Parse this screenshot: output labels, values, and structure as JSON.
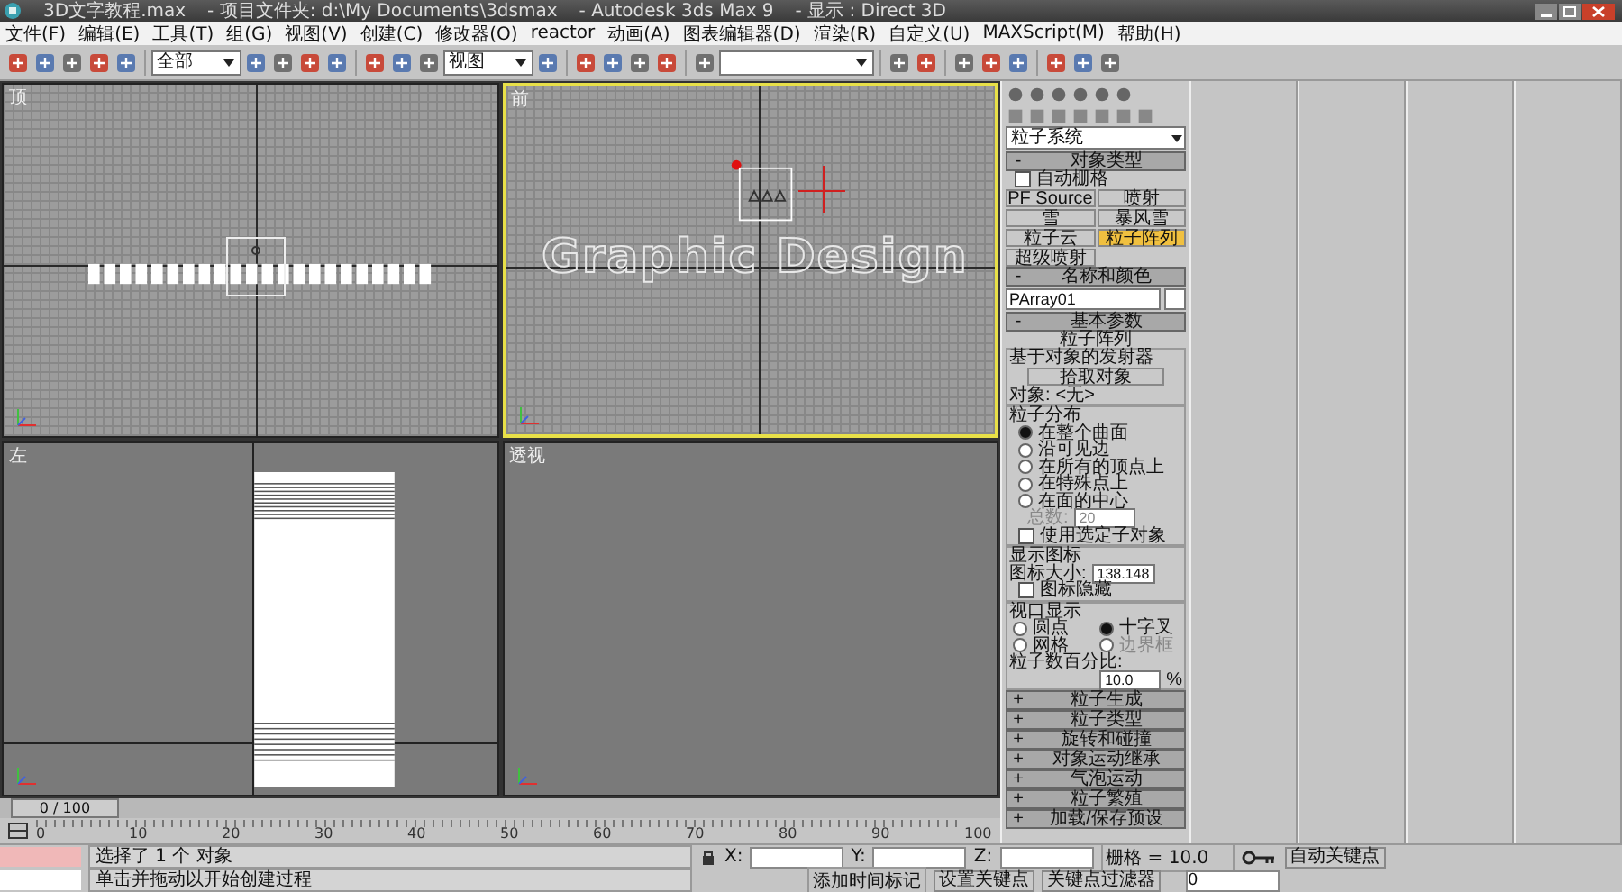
{
  "title_bar": {
    "file": "3D文字教程.max",
    "project": "- 项目文件夹: d:\\My Documents\\3dsmax",
    "app": "- Autodesk 3ds Max 9",
    "display": "- 显示 : Direct 3D"
  },
  "menu": [
    "文件(F)",
    "编辑(E)",
    "工具(T)",
    "组(G)",
    "视图(V)",
    "创建(C)",
    "修改器(O)",
    "reactor",
    "动画(A)",
    "图表编辑器(D)",
    "渲染(R)",
    "自定义(U)",
    "MAXScript(M)",
    "帮助(H)"
  ],
  "toolbar": {
    "selection_filter": "全部",
    "coordinate_system": "视图"
  },
  "viewports": [
    {
      "label": "顶",
      "kind": "top",
      "selected": false
    },
    {
      "label": "前",
      "kind": "front",
      "selected": true,
      "text": "Graphic Design"
    },
    {
      "label": "左",
      "kind": "left",
      "selected": false
    },
    {
      "label": "透视",
      "kind": "perspective",
      "selected": false
    }
  ],
  "command_panel": {
    "category": "粒子系统",
    "object_type": {
      "sign": "-",
      "title": "对象类型",
      "autogrid": {
        "label": "自动栅格",
        "checked": false
      },
      "buttons": [
        {
          "label": "PF Source",
          "selected": false
        },
        {
          "label": "喷射",
          "selected": false
        },
        {
          "label": "雪",
          "selected": false
        },
        {
          "label": "暴风雪",
          "selected": false
        },
        {
          "label": "粒子云",
          "selected": false
        },
        {
          "label": "粒子阵列",
          "selected": true
        },
        {
          "label": "超级喷射",
          "selected": false
        }
      ]
    },
    "name_color": {
      "sign": "-",
      "title": "名称和颜色",
      "name": "PArray01"
    },
    "basic": {
      "sign": "-",
      "title": "基本参数",
      "subtitle": "粒子阵列",
      "emitter_group": "基于对象的发射器",
      "pick_button": "拾取对象",
      "object_label": "对象:",
      "object_value": "<无>",
      "distribution_group": "粒子分布",
      "distribution": [
        {
          "label": "在整个曲面",
          "selected": true
        },
        {
          "label": "沿可见边",
          "selected": false
        },
        {
          "label": "在所有的顶点上",
          "selected": false
        },
        {
          "label": "在特殊点上",
          "selected": false
        },
        {
          "label": "在面的中心",
          "selected": false
        }
      ],
      "total_label": "总数:",
      "total_value": "20",
      "use_selected": {
        "label": "使用选定子对象",
        "checked": false
      },
      "icon_group": "显示图标",
      "icon_size_label": "图标大小:",
      "icon_size": "138.148",
      "icon_hidden": {
        "label": "图标隐藏",
        "checked": false
      },
      "viewport_group": "视口显示",
      "display_modes": [
        {
          "label": "圆点",
          "selected": false,
          "disabled": false
        },
        {
          "label": "十字叉",
          "selected": true,
          "disabled": false
        },
        {
          "label": "网格",
          "selected": false,
          "disabled": false
        },
        {
          "label": "边界框",
          "selected": false,
          "disabled": true
        }
      ],
      "percent_label": "粒子数百分比:",
      "percent_value": "10.0",
      "percent_unit": "%"
    },
    "rollouts": [
      {
        "sign": "+",
        "label": "粒子生成"
      },
      {
        "sign": "+",
        "label": "粒子类型"
      },
      {
        "sign": "+",
        "label": "旋转和碰撞"
      },
      {
        "sign": "+",
        "label": "对象运动继承"
      },
      {
        "sign": "+",
        "label": "气泡运动"
      },
      {
        "sign": "+",
        "label": "粒子繁殖"
      },
      {
        "sign": "+",
        "label": "加载/保存预设"
      }
    ]
  },
  "timeline": {
    "position": "0 / 100",
    "level": 0,
    "ticks": [
      "0",
      "10",
      "20",
      "30",
      "40",
      "50",
      "60",
      "70",
      "80",
      "90",
      "100"
    ]
  },
  "status": {
    "selection": "选择了 1 个 对象",
    "prompt": "单击并拖动以开始创建过程",
    "x_label": "X:",
    "y_label": "Y:",
    "z_label": "Z:",
    "grid": "栅格 = 10.0",
    "add_time_tag": "添加时间标记",
    "auto_key": "自动关键点",
    "set_key": "设置关键点",
    "key_filters": "关键点过滤器",
    "frame": "0"
  }
}
